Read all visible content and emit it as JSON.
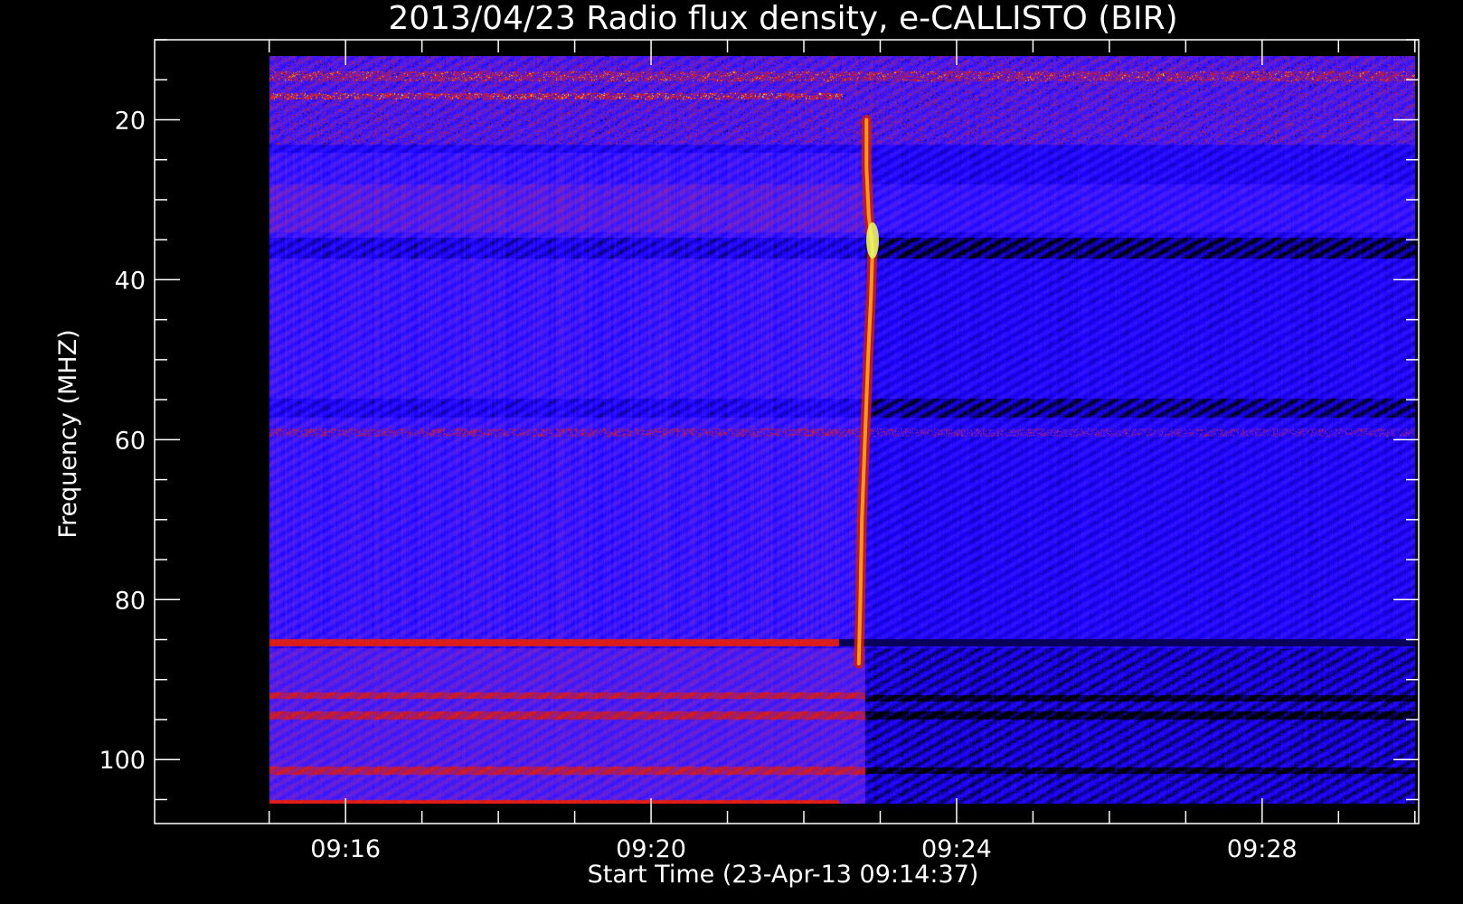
{
  "chart_data": {
    "type": "heatmap",
    "title": "2013/04/23  Radio flux density, e-CALLISTO (BIR)",
    "xlabel": "Start Time (23-Apr-13 09:14:37)",
    "ylabel": "Frequency (MHZ)",
    "x_tick_labels": [
      "09:16",
      "09:20",
      "09:24",
      "09:28"
    ],
    "x_tick_minutes": [
      16,
      20,
      24,
      28
    ],
    "x_minor_tick_minutes": [
      15,
      17,
      18,
      19,
      21,
      22,
      23,
      25,
      26,
      27,
      29,
      30
    ],
    "y_tick_labels": [
      "20",
      "40",
      "60",
      "80",
      "100"
    ],
    "y_tick_values": [
      20,
      40,
      60,
      80,
      100
    ],
    "y_minor_tick_values": [
      10,
      15,
      25,
      30,
      35,
      45,
      50,
      55,
      65,
      70,
      75,
      85,
      90,
      95,
      105
    ],
    "xlim_minutes": [
      13.5,
      30.05
    ],
    "ylim_mhz": [
      10,
      108
    ],
    "data_extent": {
      "time_minutes": [
        15.0,
        30.0
      ],
      "freq_mhz": [
        12,
        105.5
      ]
    },
    "y_inverted": true,
    "colormap": [
      "#000000",
      "#1a00ff",
      "#3a1aff",
      "#7a22c8",
      "#b8183a",
      "#ff2200",
      "#ffd000",
      "#d8ff70"
    ],
    "colors": {
      "background": "#000000",
      "axes": "#ffffff",
      "base_blue": "#1a00ff"
    },
    "burst": {
      "description_type": "type III radio burst",
      "time_minutes": [
        22.82,
        22.82,
        22.85,
        22.9,
        22.88,
        22.84,
        22.8,
        22.76,
        22.74,
        22.72
      ],
      "freq_mhz": [
        20,
        26,
        32,
        36,
        42,
        50,
        60,
        70,
        80,
        88
      ]
    }
  }
}
